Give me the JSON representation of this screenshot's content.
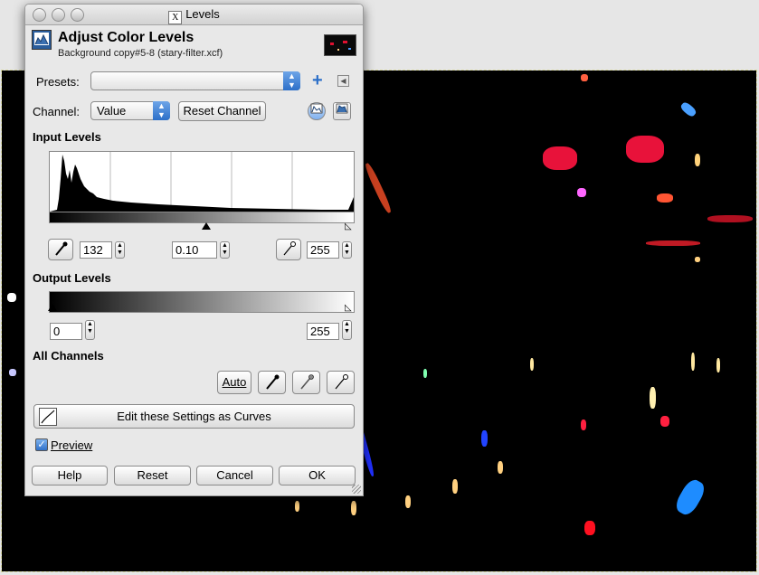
{
  "window": {
    "title": "Levels",
    "app_icon": "x11-icon"
  },
  "header": {
    "icon": "levels-tool-icon",
    "title": "Adjust Color Levels",
    "subtitle": "Background copy#5-8 (stary-filter.xcf)"
  },
  "presets": {
    "label": "Presets:",
    "value": "",
    "add_icon": "plus-icon",
    "menu_icon": "triangle-left-icon"
  },
  "channel": {
    "label": "Channel:",
    "value": "Value",
    "reset_label": "Reset Channel",
    "linear_icon": "linear-histogram-icon",
    "log_icon": "log-histogram-icon"
  },
  "input_levels": {
    "title": "Input Levels",
    "low": "132",
    "gamma": "0.10",
    "high": "255"
  },
  "output_levels": {
    "title": "Output Levels",
    "low": "0",
    "high": "255"
  },
  "all_channels": {
    "title": "All Channels",
    "auto_label": "Auto",
    "pickers": [
      "black-point-picker-icon",
      "gray-point-picker-icon",
      "white-point-picker-icon"
    ]
  },
  "curves_button": {
    "label": "Edit these Settings as Curves",
    "icon": "curves-icon"
  },
  "preview": {
    "label": "Preview",
    "checked": true
  },
  "footer": {
    "help": "Help",
    "reset": "Reset",
    "cancel": "Cancel",
    "ok": "OK"
  },
  "colors": {
    "accent": "#2c6fc8",
    "canvas_bg": "#000000"
  }
}
